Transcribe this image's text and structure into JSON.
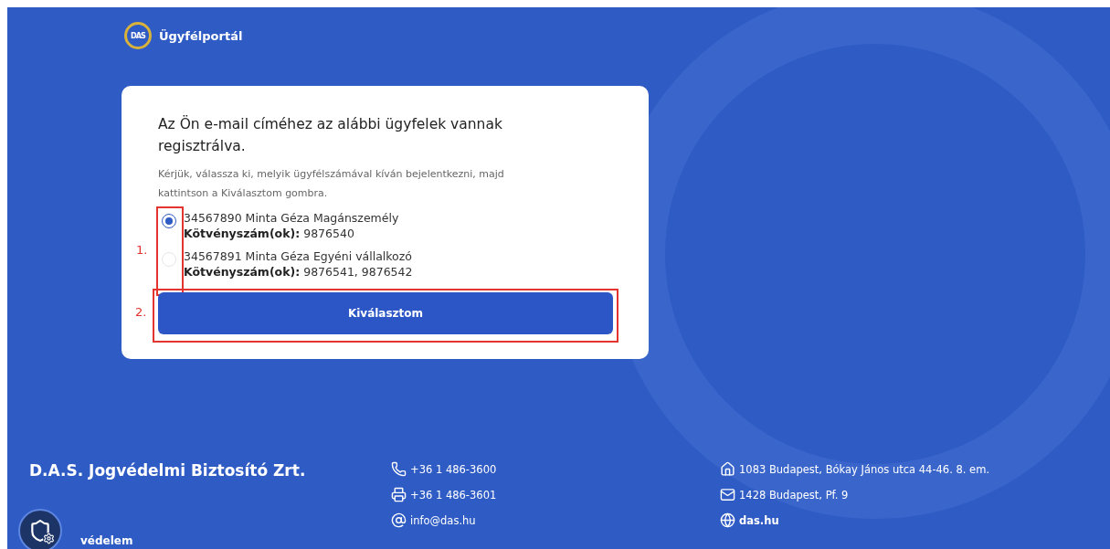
{
  "header": {
    "logo": "DAS",
    "title": "Ügyfélportál"
  },
  "card": {
    "heading": "Az Ön e-mail címéhez az alábbi ügyfelek vannak regisztrálva.",
    "instructions": "Kérjük, válassza ki, melyik ügyfélszámával kíván bejelentkezni, majd kattintson a Kiválasztom gombra.",
    "options": [
      {
        "client": "34567890 Minta Géza Magánszemély",
        "policies": "**Kötvényszám(ok):** 9876540",
        "selected": true
      },
      {
        "client": "34567891 Minta Géza Egyéni vállalkozó",
        "policies": "**Kötvényszám(ok):** 9876541, 9876542",
        "selected": false
      }
    ],
    "button": "Kiválasztom",
    "annotations": [
      "1.",
      "2."
    ]
  },
  "footer": {
    "company": "D.A.S. Jogvédelmi Biztosító Zrt.",
    "tagline": "védelem",
    "contacts": [
      {
        "kind": "phone",
        "text": "+36 1 486-3600"
      },
      {
        "kind": "fax",
        "text": "+36 1 486-3601"
      },
      {
        "kind": "email",
        "text": "info@das.hu"
      }
    ],
    "addresses": [
      {
        "kind": "home",
        "text": "1083 Budapest, Bókay János utca 44-46. 8. em."
      },
      {
        "kind": "mail",
        "text": "1428 Budapest, Pf. 9"
      },
      {
        "kind": "web",
        "text": "das.hu"
      }
    ]
  }
}
